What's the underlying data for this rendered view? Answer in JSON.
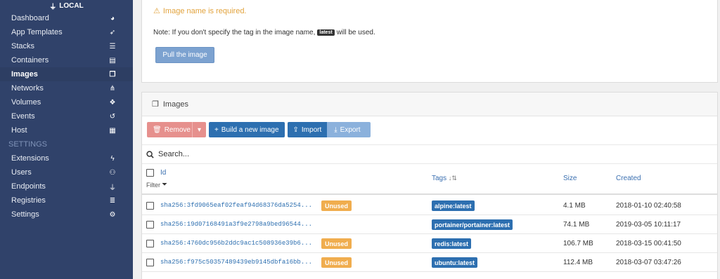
{
  "sidebar": {
    "endpoint_label": "LOCAL",
    "items": [
      {
        "label": "Dashboard",
        "icon": "tachometer-icon",
        "glyph": "◕",
        "active": false
      },
      {
        "label": "App Templates",
        "icon": "rocket-icon",
        "glyph": "➶",
        "active": false
      },
      {
        "label": "Stacks",
        "icon": "th-list-icon",
        "glyph": "☰",
        "active": false
      },
      {
        "label": "Containers",
        "icon": "server-icon",
        "glyph": "▤",
        "active": false
      },
      {
        "label": "Images",
        "icon": "clone-icon",
        "glyph": "❐",
        "active": true
      },
      {
        "label": "Networks",
        "icon": "sitemap-icon",
        "glyph": "⋔",
        "active": false
      },
      {
        "label": "Volumes",
        "icon": "cubes-icon",
        "glyph": "❖",
        "active": false
      },
      {
        "label": "Events",
        "icon": "history-icon",
        "glyph": "↺",
        "active": false
      },
      {
        "label": "Host",
        "icon": "th-icon",
        "glyph": "▦",
        "active": false
      }
    ],
    "settings_header": "SETTINGS",
    "settings_items": [
      {
        "label": "Extensions",
        "icon": "bolt-icon",
        "glyph": "ϟ"
      },
      {
        "label": "Users",
        "icon": "users-icon",
        "glyph": "⚇"
      },
      {
        "label": "Endpoints",
        "icon": "plug-icon",
        "glyph": "⏚"
      },
      {
        "label": "Registries",
        "icon": "database-icon",
        "glyph": "≣"
      },
      {
        "label": "Settings",
        "icon": "cogs-icon",
        "glyph": "⚙"
      }
    ]
  },
  "pull": {
    "warning": "Image name is required.",
    "note_prefix": "Note: If you don't specify the tag in the image name,",
    "note_tag": "latest",
    "note_suffix": "will be used.",
    "button": "Pull the image"
  },
  "images": {
    "title": "Images",
    "buttons": {
      "remove": "Remove",
      "build": "Build a new image",
      "import": "Import",
      "export": "Export"
    },
    "search_placeholder": "Search...",
    "columns": {
      "id": "Id",
      "filter": "Filter",
      "tags": "Tags",
      "size": "Size",
      "created": "Created"
    },
    "rows": [
      {
        "id": "sha256:3fd9065eaf02feaf94d68376da5254...",
        "unused": "Unused",
        "tag": "alpine:latest",
        "size": "4.1 MB",
        "created": "2018-01-10 02:40:58"
      },
      {
        "id": "sha256:19d07168491a3f9e2798a9bed96544...",
        "unused": "",
        "tag": "portainer/portainer:latest",
        "size": "74.1 MB",
        "created": "2019-03-05 10:11:17"
      },
      {
        "id": "sha256:4760dc956b2ddc9ac1c508936e39b6...",
        "unused": "Unused",
        "tag": "redis:latest",
        "size": "106.7 MB",
        "created": "2018-03-15 00:41:50"
      },
      {
        "id": "sha256:f975c50357489439eb9145dbfa16bb...",
        "unused": "Unused",
        "tag": "ubuntu:latest",
        "size": "112.4 MB",
        "created": "2018-03-07 03:47:26"
      }
    ]
  },
  "colors": {
    "sidebar": "#30426a",
    "primary": "#2d6fb0",
    "danger": "#e6908d",
    "warning": "#f0ad4e"
  }
}
